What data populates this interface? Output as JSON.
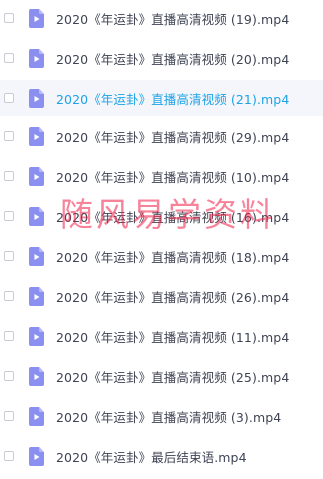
{
  "files": [
    {
      "name": "2020《年运卦》直播高清视频 (19).mp4",
      "icon": "video-file-icon"
    },
    {
      "name": "2020《年运卦》直播高清视频 (20).mp4",
      "icon": "video-file-icon"
    },
    {
      "name": "2020《年运卦》直播高清视频 (21).mp4",
      "icon": "video-file-icon"
    },
    {
      "name": "2020《年运卦》直播高清视频 (29).mp4",
      "icon": "video-file-icon"
    },
    {
      "name": "2020《年运卦》直播高清视频 (10).mp4",
      "icon": "video-file-icon"
    },
    {
      "name": "2020《年运卦》直播高清视频 (16).mp4",
      "icon": "video-file-icon"
    },
    {
      "name": "2020《年运卦》直播高清视频 (18).mp4",
      "icon": "video-file-icon"
    },
    {
      "name": "2020《年运卦》直播高清视频 (26).mp4",
      "icon": "video-file-icon"
    },
    {
      "name": "2020《年运卦》直播高清视频 (11).mp4",
      "icon": "video-file-icon"
    },
    {
      "name": "2020《年运卦》直播高清视频 (25).mp4",
      "icon": "video-file-icon"
    },
    {
      "name": "2020《年运卦》直播高清视频 (3).mp4",
      "icon": "video-file-icon"
    },
    {
      "name": "2020《年运卦》最后结束语.mp4",
      "icon": "video-file-icon"
    }
  ],
  "highlighted_index": 2,
  "watermark": "随风易学资料",
  "colors": {
    "icon": "#8b8ff0",
    "text": "#3f4454",
    "highlight_text": "#1fa3e6",
    "highlight_row": "#f4f6fb",
    "watermark": "#f01e46"
  }
}
